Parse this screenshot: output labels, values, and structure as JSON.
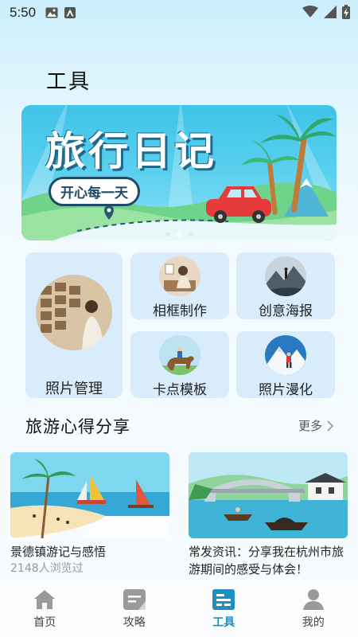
{
  "status_bar": {
    "time": "5:50"
  },
  "page": {
    "title": "工具"
  },
  "banner": {
    "title": "旅行日记",
    "subtitle": "开心每一天"
  },
  "tools": [
    {
      "label": "照片管理",
      "icon": "photo-wall-icon"
    },
    {
      "label": "相框制作",
      "icon": "photo-frame-icon"
    },
    {
      "label": "创意海报",
      "icon": "mountain-poster-icon"
    },
    {
      "label": "卡点模板",
      "icon": "horse-rider-icon"
    },
    {
      "label": "照片漫化",
      "icon": "climber-icon"
    }
  ],
  "share": {
    "section_title": "旅游心得分享",
    "more_label": "更多",
    "cards": [
      {
        "title": "景德镇游记与感悟",
        "meta": "2148人浏览过"
      },
      {
        "title": "常发资讯：分享我在杭州市旅游期间的感受与体会！",
        "meta": ""
      }
    ]
  },
  "bottom_nav": [
    {
      "label": "首页",
      "icon": "home-icon"
    },
    {
      "label": "攻略",
      "icon": "guide-icon"
    },
    {
      "label": "工具",
      "icon": "tools-icon",
      "active": true
    },
    {
      "label": "我的",
      "icon": "profile-icon"
    }
  ],
  "colors": {
    "accent": "#1f8fc3",
    "tile_bg": "#d9ecfb",
    "banner_sky": "#3fc3e8"
  }
}
